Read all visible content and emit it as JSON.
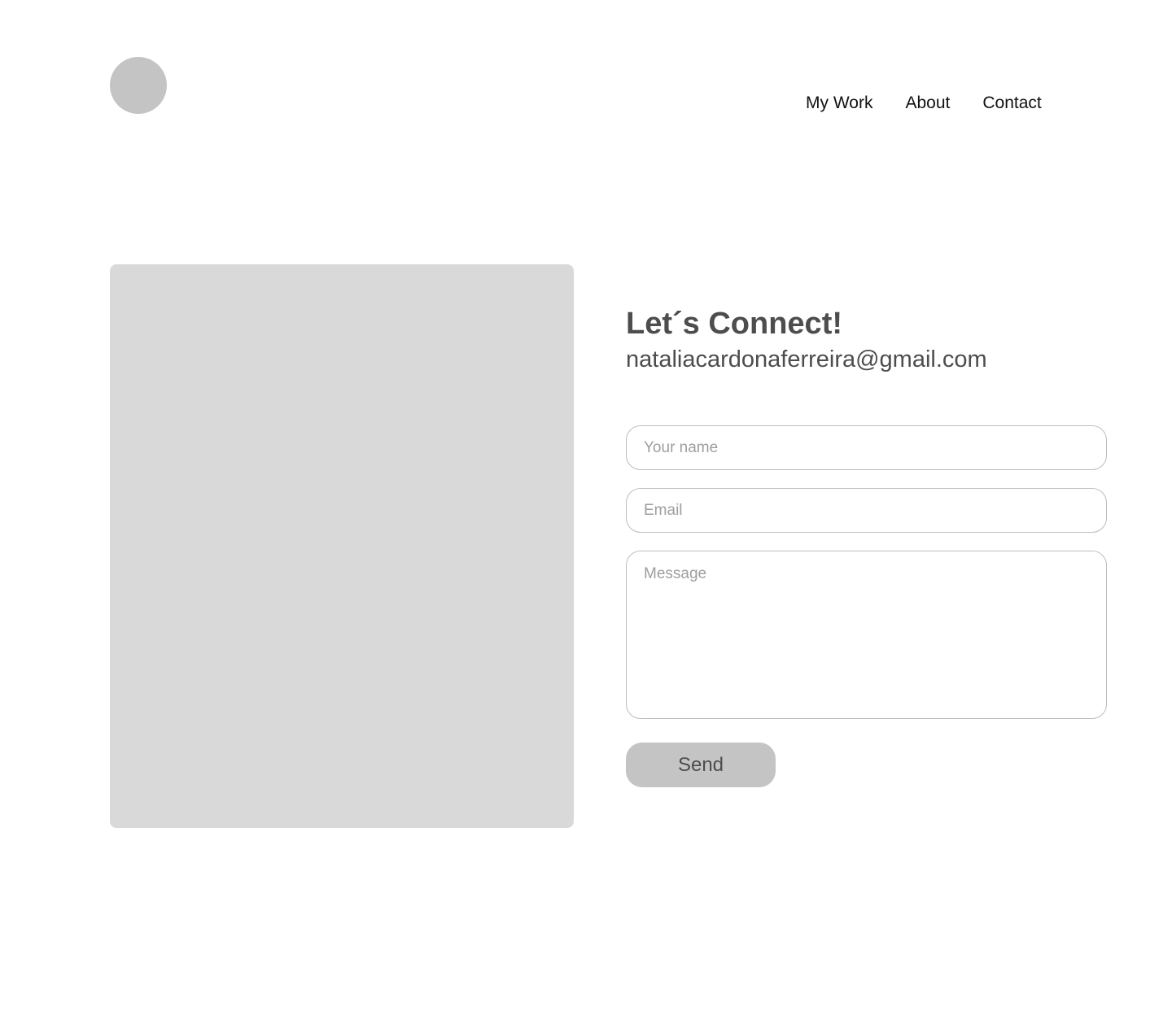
{
  "header": {
    "nav": [
      {
        "label": "My Work"
      },
      {
        "label": "About"
      },
      {
        "label": "Contact"
      }
    ]
  },
  "contact": {
    "title": "Let´s Connect!",
    "email": "nataliacardonaferreira@gmail.com"
  },
  "form": {
    "name_placeholder": "Your name",
    "name_value": "",
    "email_placeholder": "Email",
    "email_value": "",
    "message_placeholder": "Message",
    "message_value": "",
    "send_label": "Send"
  },
  "colors": {
    "placeholder_gray": "#c4c4c4",
    "image_placeholder": "#d9d9d9",
    "heading_text": "#4d4d4d",
    "field_border": "#bdbdbd"
  }
}
